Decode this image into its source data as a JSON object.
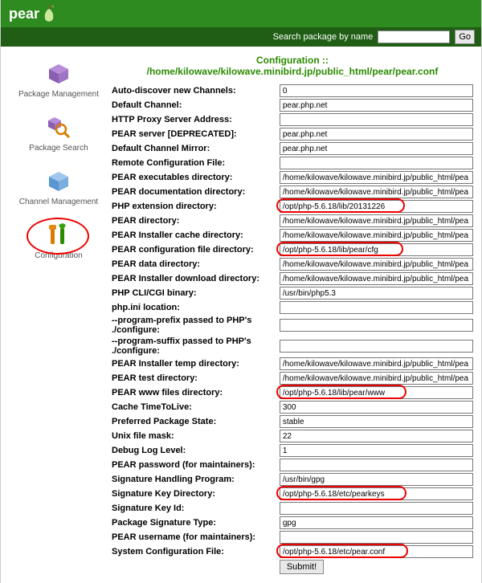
{
  "brand": "pear",
  "search": {
    "label": "Search package by name",
    "go": "Go",
    "value": ""
  },
  "sidebar": {
    "items": [
      {
        "label": "Package Management"
      },
      {
        "label": "Package Search"
      },
      {
        "label": "Channel Management"
      },
      {
        "label": "Configuration"
      }
    ]
  },
  "page_title": "Configuration :: /home/kilowave/kilowave.minibird.jp/public_html/pear/pear.conf",
  "fields": [
    {
      "label": "Auto-discover new Channels:",
      "value": "0"
    },
    {
      "label": "Default Channel:",
      "value": "pear.php.net"
    },
    {
      "label": "HTTP Proxy Server Address:",
      "value": ""
    },
    {
      "label": "PEAR server [DEPRECATED]:",
      "value": "pear.php.net"
    },
    {
      "label": "Default Channel Mirror:",
      "value": "pear.php.net"
    },
    {
      "label": "Remote Configuration File:",
      "value": ""
    },
    {
      "label": "PEAR executables directory:",
      "value": "/home/kilowave/kilowave.minibird.jp/public_html/pea"
    },
    {
      "label": "PEAR documentation directory:",
      "value": "/home/kilowave/kilowave.minibird.jp/public_html/pea"
    },
    {
      "label": "PHP extension directory:",
      "value": "/opt/php-5.6.18/lib/20131226",
      "highlight": true,
      "hl_width": 160
    },
    {
      "label": "PEAR directory:",
      "value": "/home/kilowave/kilowave.minibird.jp/public_html/pea"
    },
    {
      "label": "PEAR Installer cache directory:",
      "value": "/home/kilowave/kilowave.minibird.jp/public_html/pea"
    },
    {
      "label": "PEAR configuration file directory:",
      "value": "/opt/php-5.6.18/lib/pear/cfg",
      "highlight": true,
      "hl_width": 158
    },
    {
      "label": "PEAR data directory:",
      "value": "/home/kilowave/kilowave.minibird.jp/public_html/pea"
    },
    {
      "label": "PEAR Installer download directory:",
      "value": "/home/kilowave/kilowave.minibird.jp/public_html/pea"
    },
    {
      "label": "PHP CLI/CGI binary:",
      "value": "/usr/bin/php5.3"
    },
    {
      "label": "php.ini location:",
      "value": ""
    },
    {
      "label": "--program-prefix passed to PHP's ./configure:",
      "value": ""
    },
    {
      "label": "--program-suffix passed to PHP's ./configure:",
      "value": ""
    },
    {
      "label": "PEAR Installer temp directory:",
      "value": "/home/kilowave/kilowave.minibird.jp/public_html/pea"
    },
    {
      "label": "PEAR test directory:",
      "value": "/home/kilowave/kilowave.minibird.jp/public_html/pea"
    },
    {
      "label": "PEAR www files directory:",
      "value": "/opt/php-5.6.18/lib/pear/www",
      "highlight": true,
      "hl_width": 162
    },
    {
      "label": "Cache TimeToLive:",
      "value": "300"
    },
    {
      "label": "Preferred Package State:",
      "value": "stable"
    },
    {
      "label": "Unix file mask:",
      "value": "22"
    },
    {
      "label": "Debug Log Level:",
      "value": "1"
    },
    {
      "label": "PEAR password (for maintainers):",
      "value": ""
    },
    {
      "label": "Signature Handling Program:",
      "value": "/usr/bin/gpg"
    },
    {
      "label": "Signature Key Directory:",
      "value": "/opt/php-5.6.18/etc/pearkeys",
      "highlight": true,
      "hl_width": 162
    },
    {
      "label": "Signature Key Id:",
      "value": ""
    },
    {
      "label": "Package Signature Type:",
      "value": "gpg"
    },
    {
      "label": "PEAR username (for maintainers):",
      "value": ""
    },
    {
      "label": "System Configuration File:",
      "value": "/opt/php-5.6.18/etc/pear.conf",
      "highlight": true,
      "hl_width": 164
    }
  ],
  "submit_label": "Submit!"
}
